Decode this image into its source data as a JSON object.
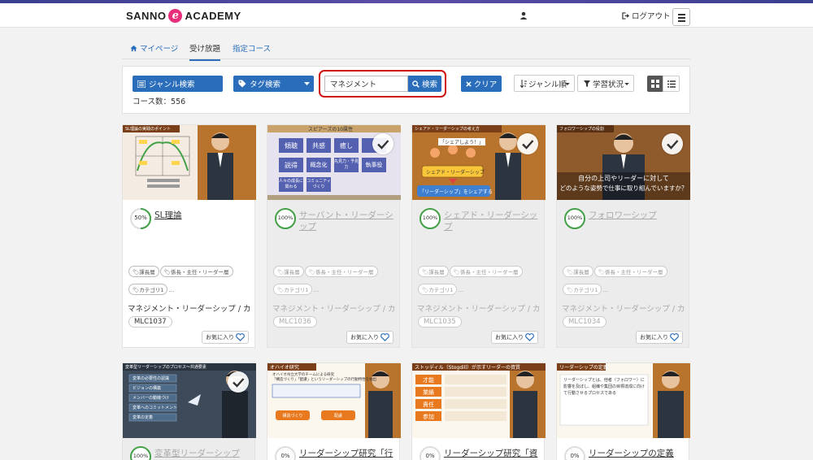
{
  "header": {
    "logo_left": "SANNO",
    "logo_mark": "e",
    "logo_right": "ACADEMY",
    "logout_label": "ログアウト"
  },
  "tabs": [
    {
      "label": "マイページ",
      "active": false
    },
    {
      "label": "受け放題",
      "active": true
    },
    {
      "label": "指定コース",
      "active": false
    }
  ],
  "filters": {
    "genre_search_label": "ジャンル検索",
    "tag_search_label": "タグ検索",
    "search_value": "マネジメント",
    "search_button_label": "検索",
    "clear_label": "クリア",
    "sort_label": "ジャンル順",
    "status_label": "学習状況",
    "course_count": "コース数：556"
  },
  "fav_label": "お気に入り",
  "cards": [
    {
      "title": "SL理論",
      "progress": "50%",
      "progress_value": 50,
      "completed": false,
      "tags": [
        "課長層",
        "係長・主任・リーダー層",
        "カテゴリ1",
        "…"
      ],
      "category": "マネジメント・リーダーシップ / カ…",
      "code": "MLC1037"
    },
    {
      "title": "サーバント・リーダーシップ",
      "progress": "100%",
      "progress_value": 100,
      "completed": true,
      "tags": [
        "課長層",
        "係長・主任・リーダー層",
        "カテゴリ1",
        "…"
      ],
      "category": "マネジメント・リーダーシップ / カ…",
      "code": "MLC1036"
    },
    {
      "title": "シェアド・リーダーシップ",
      "progress": "100%",
      "progress_value": 100,
      "completed": true,
      "tags": [
        "課長層",
        "係長・主任・リーダー層",
        "カテゴリ1",
        "…"
      ],
      "category": "マネジメント・リーダーシップ / カ…",
      "code": "MLC1035"
    },
    {
      "title": "フォロワーシップ",
      "progress": "100%",
      "progress_value": 100,
      "completed": true,
      "tags": [
        "課長層",
        "係長・主任・リーダー層",
        "カテゴリ1",
        "…"
      ],
      "category": "マネジメント・リーダーシップ / カ…",
      "code": "MLC1034"
    },
    {
      "title": "変革型リーダーシップ",
      "progress": "100%",
      "progress_value": 100,
      "completed": true
    },
    {
      "title": "リーダーシップ研究「行",
      "progress": "0%",
      "progress_value": 0,
      "completed": false
    },
    {
      "title": "リーダーシップ研究「資",
      "progress": "0%",
      "progress_value": 0,
      "completed": false
    },
    {
      "title": "リーダーシップの定義 ～",
      "progress": "0%",
      "progress_value": 0,
      "completed": false
    }
  ],
  "thumbnails": {
    "c1_header": "SL理論の実践のポイント",
    "c2_header": "スピアーズの10属性",
    "c2_items": [
      "傾聴",
      "共感",
      "癒し",
      "気づき",
      "説得",
      "概念化",
      "先見力・予見力",
      "執事役",
      "人々の成長に関わる",
      "コミュニティづくり"
    ],
    "c3_header": "シェアド・リーダーシップの考え方",
    "c3_bubble": "「シェアしよう！」",
    "c3_box1": "シェアド・リーダーシップ",
    "c3_box2": "「リーダーシップ」をシェアする",
    "c4_header": "フォロワーシップの役割",
    "c4_text1": "自分の上司やリーダーに対して",
    "c4_text2": "どのような姿勢で仕事に取り組んでいますか？",
    "c5_header": "変革型リーダーシップのプロセス～共通要素",
    "c5_items": [
      "変革の必要性の認識",
      "ビジョンの構築",
      "メンバーの動機づけ",
      "変革へのコミットメント",
      "変革の定着"
    ],
    "c6_header": "オハイオ研究",
    "c6_line1": "オハイオ州立大学のチームによる研究",
    "c6_line2": "「構造づくり」「配慮」というリーダーシップの行動特性を抽出",
    "c6_box1": "構造づくり",
    "c6_box2": "配慮",
    "c7_header": "ストッディル（Stogdill）が示すリーダーの資質",
    "c7_items": [
      "才能",
      "業績",
      "責任",
      "参加"
    ],
    "c8_header": "リーダーシップの定義",
    "c8_text": "リーダーシップとは、他者（フォロワー）に影響を及ぼし、組織や集団の目標達成に向けて行動させるプロセスである"
  }
}
